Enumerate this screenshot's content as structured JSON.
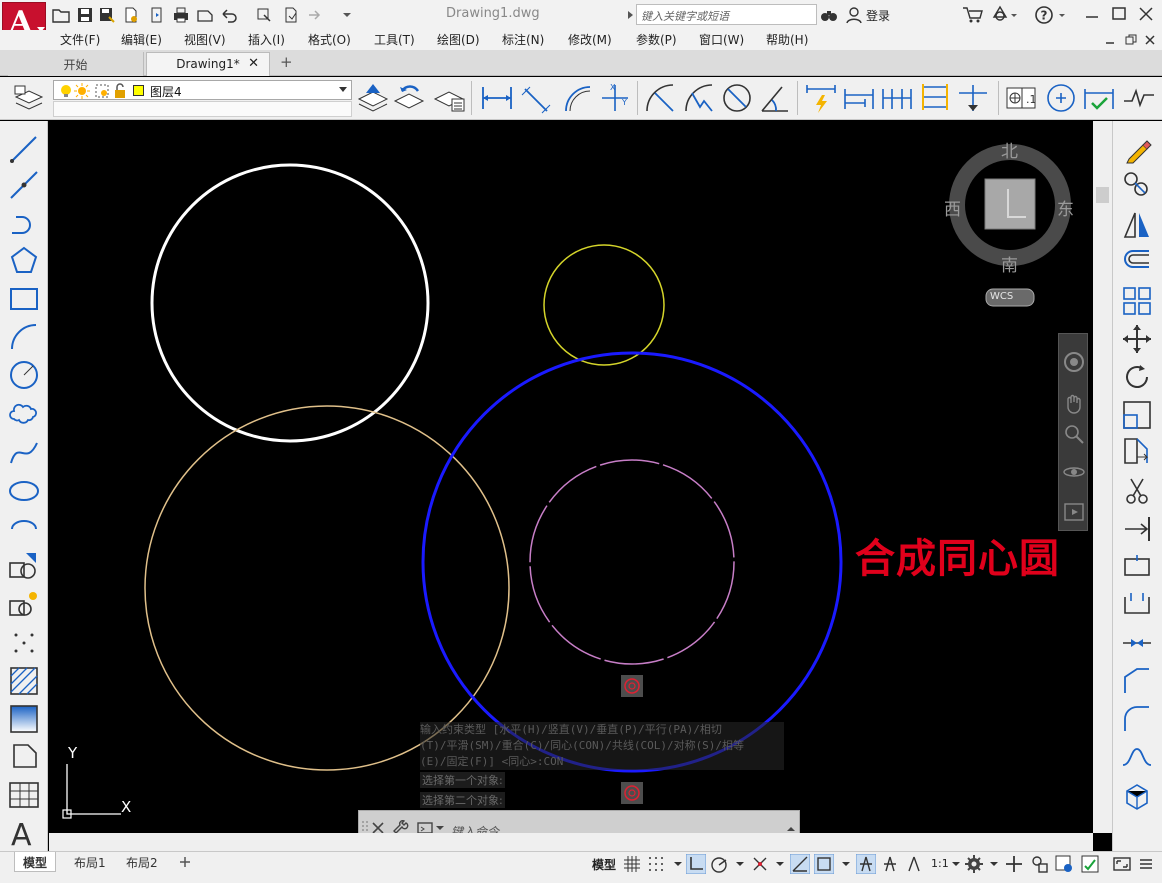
{
  "app": {
    "document_title": "Drawing1.dwg",
    "search_placeholder": "键入关键字或短语",
    "login_label": "登录"
  },
  "menu": [
    "文件(F)",
    "编辑(E)",
    "视图(V)",
    "插入(I)",
    "格式(O)",
    "工具(T)",
    "绘图(D)",
    "标注(N)",
    "修改(M)",
    "参数(P)",
    "窗口(W)",
    "帮助(H)"
  ],
  "tabs": {
    "start": "开始",
    "drawing": "Drawing1*",
    "close_glyph": "✕",
    "add_glyph": "+"
  },
  "layer": {
    "name": "图层4",
    "color": "#ffff00"
  },
  "viewcube": {
    "north": "北",
    "south": "南",
    "east": "东",
    "west": "西",
    "wcs": "WCS"
  },
  "annotation": {
    "text": "合成同心圆",
    "color": "#e0001b"
  },
  "command": {
    "history": [
      "输入约束类型 [水平(H)/竖直(V)/垂直(P)/平行(PA)/相切",
      "(T)/平滑(SM)/重合(C)/同心(CON)/共线(COL)/对称(S)/相等",
      "(E)/固定(F)] <同心>:CON"
    ],
    "prompt_first": "选择第一个对象:",
    "prompt_second": "选择第二个对象:",
    "input_placeholder": "键入命令"
  },
  "ucs": {
    "y_label": "Y",
    "x_label": "X"
  },
  "layouts": [
    "模型",
    "布局1",
    "布局2"
  ],
  "status": {
    "model_label": "模型",
    "scale": "1:1"
  },
  "circles": {
    "white": "#ffffff",
    "yellow": "#d4d42a",
    "tan": "#e0c08a",
    "blue": "#1a1aff",
    "magenta": "#c77ec7"
  }
}
